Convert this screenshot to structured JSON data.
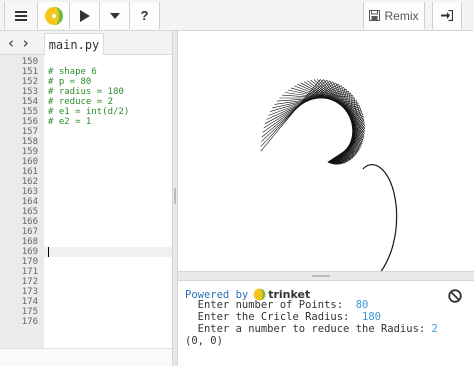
{
  "toolbar": {
    "menu_icon": "hamburger-menu-icon",
    "logo_icon": "trinket-logo-icon",
    "run_icon": "play-icon",
    "dropdown_icon": "caret-down-icon",
    "help_label": "?",
    "remix_label": "Remix",
    "remix_icon": "save-icon",
    "login_icon": "sign-in-icon"
  },
  "editor": {
    "nav_arrows": "‹ ›",
    "file_tab": "main.py",
    "line_numbers": [
      "150",
      "151",
      "152",
      "153",
      "154",
      "155",
      "156",
      "157",
      "158",
      "159",
      "160",
      "161",
      "162",
      "163",
      "164",
      "165",
      "166",
      "167",
      "168",
      "169",
      "170",
      "171",
      "172",
      "173",
      "174",
      "175",
      "176"
    ],
    "code_lines": [
      "",
      "# shape 6",
      "# p = 80",
      "# radius = 180",
      "# reduce = 2",
      "# e1 = int(d/2)",
      "# e2 = 1"
    ],
    "active_line": "169"
  },
  "console": {
    "powered_by": "Powered by",
    "brand": "trinket",
    "lines": [
      {
        "prompt": "  Enter number of Points:  ",
        "value": "80"
      },
      {
        "prompt": "  Enter the Cricle Radius:  ",
        "value": "180"
      },
      {
        "prompt": "  Enter a number to reduce the Radius: ",
        "value": "2"
      },
      {
        "prompt": "(0, 0)",
        "value": ""
      }
    ],
    "clear_icon": "clear-console-icon"
  },
  "colors": {
    "accent": "#2a6fba",
    "comment": "#2e8b2e",
    "value": "#3a9bd8",
    "logo_yellow": "#f5c518",
    "logo_green": "#6cbf3a"
  }
}
